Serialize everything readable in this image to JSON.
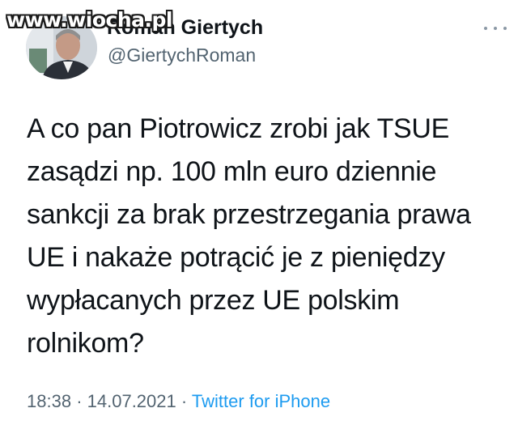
{
  "watermark": "www.wiocha.pl",
  "author": {
    "display_name": "Roman Giertych",
    "handle": "@GiertychRoman",
    "avatar_icon": "profile-photo"
  },
  "more_icon": "more-horizontal-icon",
  "tweet": {
    "lines": [
      "A co pan Piotrowicz zrobi jak TSUE",
      "zasądzi np. 100 mln euro dziennie",
      "sankcji za brak przestrzegania prawa",
      "UE i nakaże potrącić je z pieniędzy",
      "wypłacanych przez UE polskim",
      "rolnikom?"
    ]
  },
  "meta": {
    "time": "18:38",
    "separator": "·",
    "date": "14.07.2021",
    "source": "Twitter for iPhone"
  },
  "colors": {
    "text": "#0f1419",
    "secondary": "#536471",
    "link": "#1d9bf0"
  }
}
